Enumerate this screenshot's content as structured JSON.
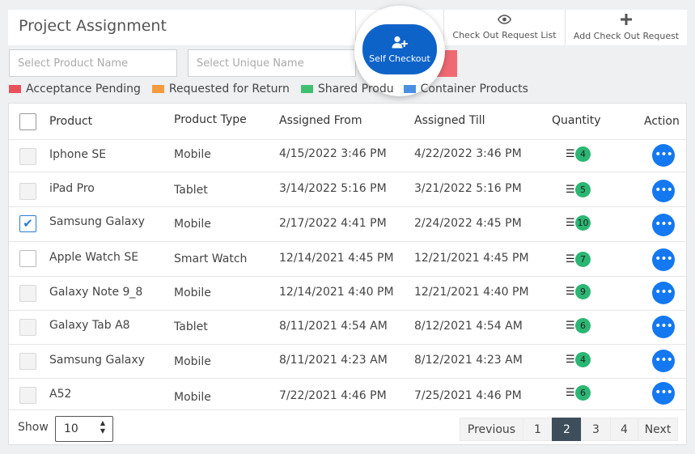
{
  "header": {
    "title": "Project Assignment",
    "checkout_list_label": "Check Out Request List",
    "add_checkout_label": "Add Check Out Request",
    "self_checkout_label": "Self Checkout"
  },
  "filters": {
    "product_placeholder": "Select Product Name",
    "unique_placeholder": "Select Unique Name"
  },
  "legend": [
    {
      "label": "Acceptance Pending",
      "color": "#e8505b"
    },
    {
      "label": "Requested for Return",
      "color": "#f79a3e"
    },
    {
      "label": "Shared Produ",
      "color": "#3fbf6f"
    },
    {
      "label": "Container Products",
      "color": "#4a90e2"
    }
  ],
  "table": {
    "columns": [
      "Product",
      "Product Type",
      "Assigned From",
      "Assigned Till",
      "Quantity",
      "Action"
    ],
    "rows": [
      {
        "product": "Iphone SE",
        "type": "Mobile",
        "from": "4/15/2022 3:46 PM",
        "till": "4/22/2022 3:46 PM",
        "qty": "4",
        "checkbox": "disabled"
      },
      {
        "product": "iPad Pro",
        "type": "Tablet",
        "from": "3/14/2022 5:16 PM",
        "till": "3/21/2022 5:16 PM",
        "qty": "5",
        "checkbox": "disabled"
      },
      {
        "product": "Samsung Galaxy",
        "type": "Mobile",
        "from": "2/17/2022 4:41 PM",
        "till": "2/24/2022 4:45 PM",
        "qty": "10",
        "checkbox": "checked"
      },
      {
        "product": "Apple Watch SE",
        "type": "Smart Watch",
        "from": "12/14/2021 4:45 PM",
        "till": "12/21/2021 4:45 PM",
        "qty": "7",
        "checkbox": "empty"
      },
      {
        "product": "Galaxy Note 9_8",
        "type": "Mobile",
        "from": "12/14/2021 4:40 PM",
        "till": "12/21/2021 4:40 PM",
        "qty": "9",
        "checkbox": "disabled"
      },
      {
        "product": "Galaxy Tab A8",
        "type": "Tablet",
        "from": "8/11/2021 4:54 AM",
        "till": "8/12/2021 4:54 AM",
        "qty": "6",
        "checkbox": "disabled"
      },
      {
        "product": "Samsung Galaxy",
        "type": "Mobile",
        "from": "8/11/2021 4:23 AM",
        "till": "8/12/2021 4:23 AM",
        "qty": "4",
        "checkbox": "disabled"
      },
      {
        "product": "A52",
        "type": "Mobile",
        "from": "7/22/2021 4:46 PM",
        "till": "7/25/2021 4:46 PM",
        "qty": "6",
        "checkbox": "disabled"
      }
    ]
  },
  "footer": {
    "show_label": "Show",
    "page_size": "10",
    "previous_label": "Previous",
    "next_label": "Next",
    "pages": [
      "1",
      "2",
      "3",
      "4"
    ],
    "current_page": "2"
  },
  "icons": {
    "eye": "eye-icon",
    "plus": "plus-icon",
    "add_user": "add-user-icon",
    "list": "list-icon",
    "more": "more-icon"
  }
}
